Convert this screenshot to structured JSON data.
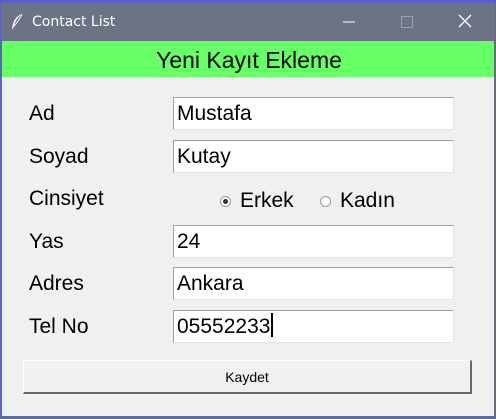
{
  "window": {
    "title": "Contact List",
    "icons": {
      "app": "feather-icon",
      "minimize": "minimize-icon",
      "maximize": "maximize-icon",
      "close": "close-icon"
    },
    "colors": {
      "titlebar": "#6b7384",
      "banner": "#66ff66",
      "background": "#f0f0f0"
    }
  },
  "form": {
    "heading": "Yeni Kayıt Ekleme",
    "fields": {
      "ad": {
        "label": "Ad",
        "value": "Mustafa"
      },
      "soyad": {
        "label": "Soyad",
        "value": "Kutay"
      },
      "cinsiyet": {
        "label": "Cinsiyet",
        "options": [
          {
            "label": "Erkek",
            "checked": true
          },
          {
            "label": "Kadın",
            "checked": false
          }
        ]
      },
      "yas": {
        "label": "Yas",
        "value": "24"
      },
      "adres": {
        "label": "Adres",
        "value": "Ankara"
      },
      "telno": {
        "label": "Tel No",
        "value": "05552233"
      }
    },
    "save_label": "Kaydet"
  }
}
